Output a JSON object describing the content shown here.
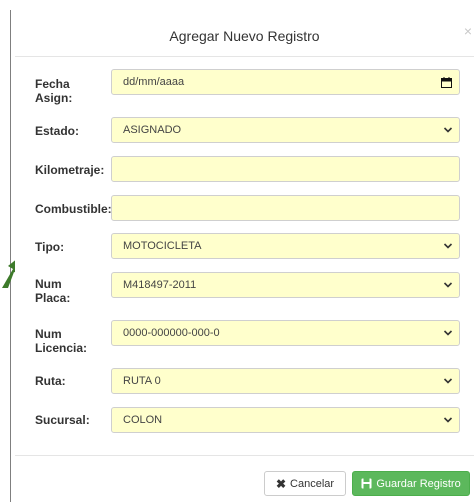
{
  "modal": {
    "title": "Agregar Nuevo Registro",
    "close_glyph": "×"
  },
  "form": {
    "fecha": {
      "label_line1": "Fecha",
      "label_line2": "Asign:",
      "value": "dd/mm/aaaa"
    },
    "estado": {
      "label": "Estado:",
      "value": "ASIGNADO"
    },
    "kilometraje": {
      "label": "Kilometraje:",
      "value": ""
    },
    "combustible": {
      "label": "Combustible:",
      "value": ""
    },
    "tipo": {
      "label": "Tipo:",
      "value": "MOTOCICLETA"
    },
    "placa": {
      "label_line1": "Num",
      "label_line2": "Placa:",
      "value": "M418497-2011"
    },
    "licencia": {
      "label_line1": "Num",
      "label_line2": "Licencia:",
      "value": "0000-000000-000-0"
    },
    "ruta": {
      "label": "Ruta:",
      "value": "RUTA 0"
    },
    "sucursal": {
      "label": "Sucursal:",
      "value": "COLON"
    }
  },
  "footer": {
    "cancel_label": "Cancelar",
    "save_label": "Guardar Registro"
  },
  "colors": {
    "field_bg": "#ffffcc",
    "primary_green": "#5cb85c",
    "arrow_green": "#3d7a2a"
  },
  "icons": {
    "calendar": "calendar-icon",
    "chevron": "chevron-down-icon",
    "cancel": "x-icon",
    "save": "save-icon",
    "arrow": "arrow-pointer-icon"
  }
}
